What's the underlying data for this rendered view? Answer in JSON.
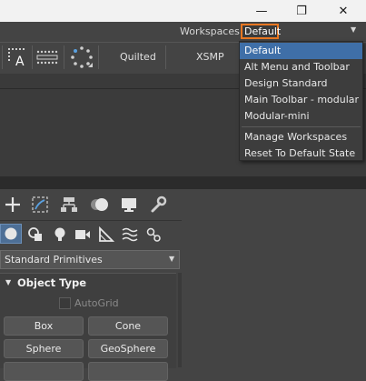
{
  "window": {
    "minimize_glyph": "—",
    "restore_glyph": "❐",
    "close_glyph": "✕"
  },
  "workspaces": {
    "label": "Workspaces:",
    "current": "Default",
    "menu": [
      {
        "label": "Default",
        "selected": true
      },
      {
        "label": "Alt Menu and Toolbar"
      },
      {
        "label": "Design Standard"
      },
      {
        "label": "Main Toolbar - modular"
      },
      {
        "label": "Modular-mini"
      }
    ],
    "menu_actions": [
      {
        "label": "Manage Workspaces"
      },
      {
        "label": "Reset To Default State"
      }
    ]
  },
  "toolbar": {
    "icons": [
      "text-icon",
      "dotted-bar-icon",
      "dotted-circle-icon"
    ],
    "quilted_label": "Quilted",
    "xsmp_label": "XSMP"
  },
  "command_panel": {
    "tabs": [
      "create-icon",
      "modify-icon",
      "hierarchy-icon",
      "motion-icon",
      "display-icon",
      "utilities-icon"
    ],
    "categories": [
      "geometry-icon",
      "shapes-icon",
      "lights-icon",
      "cameras-icon",
      "helpers-icon",
      "spacewarps-icon",
      "systems-icon"
    ],
    "dropdown_value": "Standard Primitives",
    "rollout_title": "Object Type",
    "autogrid_label": "AutoGrid",
    "buttons": [
      "Box",
      "Cone",
      "Sphere",
      "GeoSphere"
    ]
  },
  "colors": {
    "accent": "#e87722",
    "selection": "#3f6fa8",
    "background": "#444444"
  }
}
